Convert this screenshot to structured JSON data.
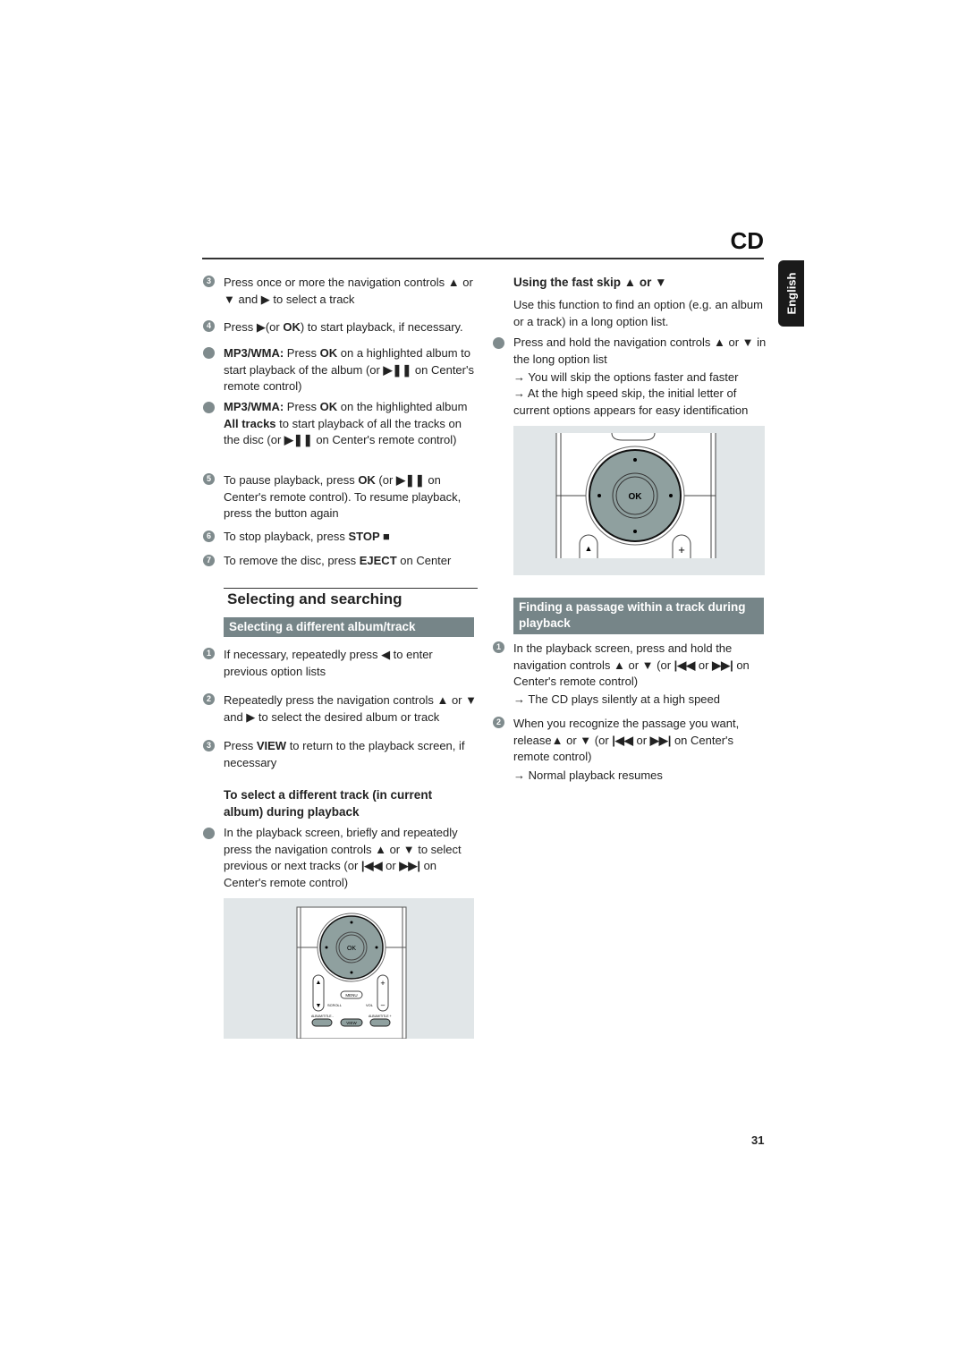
{
  "header": {
    "section": "CD",
    "language_tab": "English"
  },
  "left": {
    "items": [
      {
        "marker": "3",
        "runs": [
          [
            "Press once or more the navigation controls  ▲  or ▼  and ▶ to select a track",
            0
          ]
        ]
      },
      {
        "marker": "4",
        "runs": [
          [
            "Press ▶(or ",
            0
          ],
          [
            "OK",
            1
          ],
          [
            ") to start playback, if necessary.",
            0
          ]
        ]
      },
      {
        "marker": "",
        "runs": [
          [
            "MP3/WMA:",
            1
          ],
          [
            " Press ",
            0
          ],
          [
            "OK",
            1
          ],
          [
            " on a highlighted album to start playback of the album (or ",
            0
          ],
          [
            "▶❚❚",
            1
          ],
          [
            "  on Center's remote control)",
            0
          ]
        ]
      },
      {
        "marker": "",
        "runs": [
          [
            "MP3/WMA:",
            1
          ],
          [
            " Press ",
            0
          ],
          [
            "OK",
            1
          ],
          [
            " on the highlighted album ",
            0
          ],
          [
            "All tracks",
            1
          ],
          [
            " to start playback of all the tracks on the disc (or ",
            0
          ],
          [
            "▶❚❚",
            1
          ],
          [
            "  on Center's remote control)",
            0
          ]
        ]
      },
      {
        "marker": "5",
        "runs": [
          [
            "To pause playback, press ",
            0
          ],
          [
            "OK",
            1
          ],
          [
            " (or ",
            0
          ],
          [
            "▶❚❚",
            1
          ],
          [
            "  on Center's remote control). To resume playback, press the button again",
            0
          ]
        ]
      },
      {
        "marker": "6",
        "runs": [
          [
            "To stop playback, press ",
            0
          ],
          [
            "STOP ■",
            1
          ]
        ]
      },
      {
        "marker": "7",
        "runs": [
          [
            "To remove the disc, press ",
            0
          ],
          [
            "EJECT",
            1
          ],
          [
            " on Center",
            0
          ]
        ]
      }
    ],
    "section_title": "Selecting and searching",
    "subsection_title": "Selecting a different album/track",
    "items2": [
      {
        "marker": "1",
        "runs": [
          [
            "If necessary, repeatedly press ◀  to enter previous option lists",
            0
          ]
        ]
      },
      {
        "marker": "2",
        "runs": [
          [
            "Repeatedly press the navigation controls  ▲  or ▼  and ▶  to select the desired album or track",
            0
          ]
        ]
      },
      {
        "marker": "3",
        "runs": [
          [
            "Press ",
            0
          ],
          [
            "VIEW",
            1
          ],
          [
            "  to return to the playback screen, if necessary",
            0
          ]
        ]
      }
    ],
    "sub_heading": "To select a different track (in current album) during playback",
    "items3": [
      {
        "marker": "",
        "runs": [
          [
            "In the playback screen, briefly and repeatedly press the navigation controls ▲  or  ▼ to select previous or next tracks (or ",
            0
          ],
          [
            "|◀◀",
            1
          ],
          [
            "  or  ",
            0
          ],
          [
            "▶▶|",
            1
          ],
          [
            " on Center's remote control)",
            0
          ]
        ]
      }
    ],
    "remote_labels": {
      "ok": "OK",
      "menu": "MENU",
      "scroll": "SCROLL",
      "vol": "VOL",
      "album_prev": "ALBUM/TITLE -",
      "album_next": "ALBUM/TITLE +",
      "view": "VIEW"
    }
  },
  "right": {
    "heading": "Using the fast skip  ▲  or   ▼",
    "intro": "Use this function to find an option (e.g. an album or a track) in a long option list.",
    "items": [
      {
        "marker": "",
        "runs": [
          [
            "Press and hold the navigation controls  ▲  or  ▼ in the long option list",
            0
          ]
        ]
      }
    ],
    "results": [
      "→ You will skip the options faster and faster",
      "→ At the high speed skip, the initial letter of current options appears for easy identification"
    ],
    "remote_labels": {
      "ok": "OK"
    },
    "subsection_title": "Finding a passage within a track during playback",
    "items2": [
      {
        "marker": "1",
        "runs": [
          [
            "In the playback screen, press and hold the navigation controls  ▲  or ▼ (or ",
            0
          ],
          [
            "|◀◀",
            1
          ],
          [
            "  or ",
            0
          ],
          [
            "▶▶|",
            1
          ],
          [
            " on Center's remote control)",
            0
          ]
        ],
        "result": "→ The CD plays silently at a high speed"
      },
      {
        "marker": "2",
        "runs": [
          [
            "When you recognize the passage you want, release▲  or ▼ (or ",
            0
          ],
          [
            "|◀◀",
            1
          ],
          [
            "  or ",
            0
          ],
          [
            "▶▶|",
            1
          ],
          [
            " on Center's remote control)",
            0
          ]
        ],
        "result": "→ Normal playback resumes"
      }
    ]
  },
  "footer": {
    "page_number": "31"
  },
  "colors": {
    "bar": "#768588",
    "picture_bg": "#e1e6e8",
    "dpad": "#8fa09f"
  }
}
